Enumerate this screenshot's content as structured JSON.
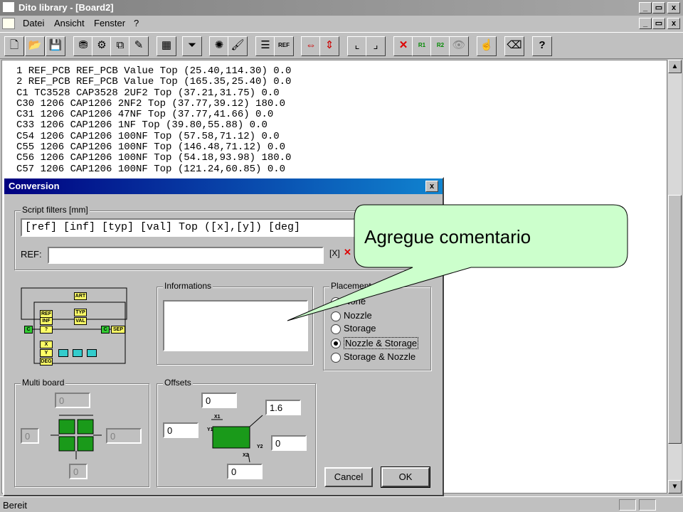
{
  "window": {
    "title": "Dito library - [Board2]",
    "controls": [
      "_",
      "▭",
      "x"
    ]
  },
  "menubar": {
    "items": [
      "Datei",
      "Ansicht",
      "Fenster",
      "?"
    ]
  },
  "toolbar": {
    "buttons": [
      "new-icon",
      "open-icon",
      "save-icon",
      "filter-icon",
      "component-icon",
      "copy-icon",
      "edit-icon",
      "board-icon",
      "funnel-icon",
      "settings-icon",
      "brush-icon",
      "list-icon",
      "ref-icon",
      "flip-h-icon",
      "flip-v-icon",
      "axis-x-icon",
      "axis-y-icon",
      "delete-icon",
      "r1-icon",
      "r2-icon",
      "eye-icon",
      "hand-icon",
      "eraser-icon",
      "help-icon"
    ],
    "ref_label": "REF",
    "r1_label": "R1",
    "r2_label": "R2"
  },
  "document": {
    "lines": [
      "1 REF_PCB REF_PCB Value Top (25.40,114.30) 0.0",
      "2 REF_PCB REF_PCB Value Top (165.35,25.40) 0.0",
      "C1 TC3528 CAP3528 2UF2 Top (37.21,31.75) 0.0",
      "C30 1206 CAP1206 2NF2 Top (37.77,39.12) 180.0",
      "C31 1206 CAP1206 47NF Top (37.77,41.66) 0.0",
      "C33 1206 CAP1206 1NF Top (39.80,55.88) 0.0",
      "C54 1206 CAP1206 100NF Top (57.58,71.12) 0.0",
      "C55 1206 CAP1206 100NF Top (146.48,71.12) 0.0",
      "C56 1206 CAP1206 100NF Top (54.18,93.98) 180.0",
      "C57 1206 CAP1206 100NF Top (121.24,60.85) 0.0"
    ]
  },
  "status": {
    "text": "Bereit"
  },
  "dialog": {
    "title": "Conversion",
    "script_filters_label": "Script filters [mm]",
    "script_filter_value": "[ref] [inf] [typ] [val] Top ([x],[y]) [deg]",
    "ref_label": "REF:",
    "ref_value": "",
    "informations_label": "Informations",
    "informations_value": "",
    "placement_label": "Placement",
    "placement_options": [
      "None",
      "Nozzle",
      "Storage",
      "Nozzle & Storage",
      "Storage & Nozzle"
    ],
    "placement_selected": "Nozzle & Storage",
    "flow_labels": [
      "ART",
      "REF",
      "INF",
      "TYP",
      "VAL",
      "?",
      "SEP",
      "X",
      "Y",
      "DEG",
      "C",
      "C"
    ],
    "multiboard_label": "Multi board",
    "multiboard_values": {
      "top": "0",
      "left": "0",
      "right": "0",
      "bottom": "0"
    },
    "offsets_label": "Offsets",
    "offset_values": {
      "top": "0",
      "left": "0",
      "rotation": "1.6",
      "right": "0",
      "bottom": "0"
    },
    "offset_diagram_labels": [
      "X1",
      "Y1",
      "Y2",
      "X2"
    ],
    "cancel_label": "Cancel",
    "ok_label": "OK"
  },
  "callout": {
    "text": "Agregue comentario",
    "fill": "#ccffcc"
  }
}
